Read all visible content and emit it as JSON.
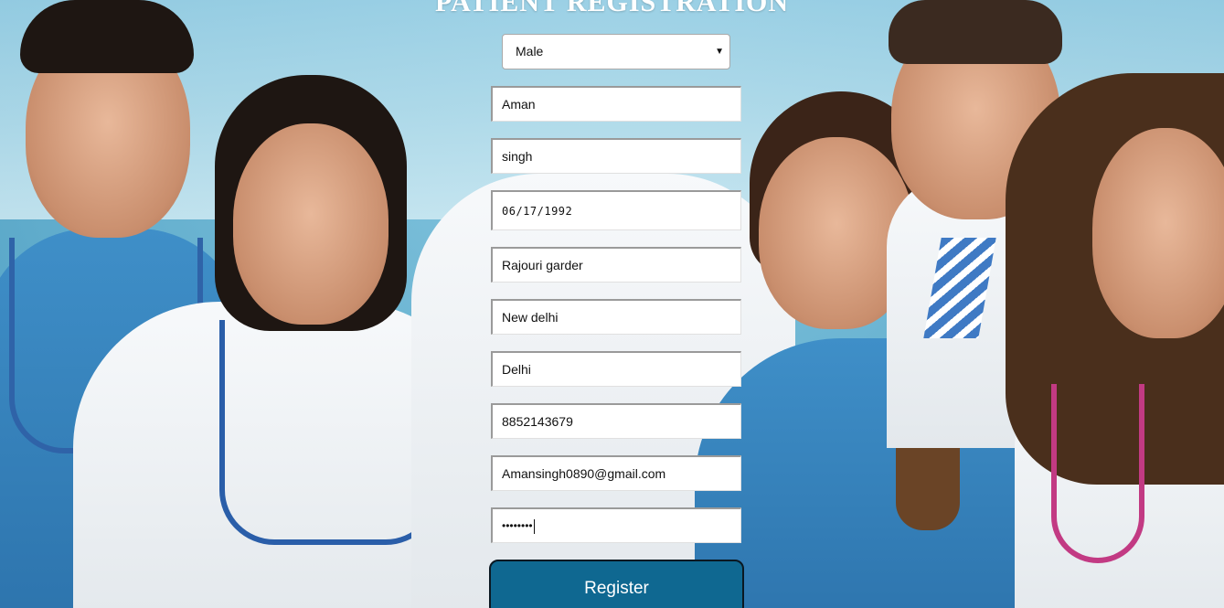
{
  "page": {
    "title": "PATIENT REGISTRATION"
  },
  "form": {
    "gender": {
      "selected": "Male",
      "arrow": "▼"
    },
    "first_name": "Aman",
    "last_name": "singh",
    "dob": "06/17/1992",
    "address": "Rajouri garder",
    "city": "New delhi",
    "state": "Delhi",
    "phone": "8852143679",
    "email": "Amansingh0890@gmail.com",
    "password": "••••••••",
    "register_label": "Register"
  },
  "colors": {
    "button_bg": "#0f6891",
    "button_text": "#ffffff",
    "title_color": "#ffffff"
  }
}
